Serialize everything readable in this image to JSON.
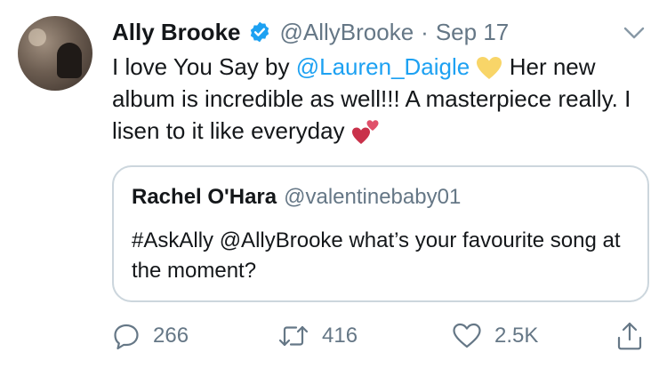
{
  "tweet": {
    "author_name": "Ally Brooke",
    "handle": "@AllyBrooke",
    "separator": "·",
    "date": "Sep 17",
    "text_part1": "I love You Say by ",
    "mention": "@Lauren_Daigle",
    "text_part2": " Her new album is incredible as well!!! A masterpiece really. I lisen to it like everyday "
  },
  "quote": {
    "author_name": "Rachel O'Hara",
    "handle": "@valentinebaby01",
    "text": "#AskAlly @AllyBrooke what’s your favourite song at the moment?"
  },
  "actions": {
    "replies": "266",
    "retweets": "416",
    "likes": "2.5K"
  },
  "icons": {
    "verified": "verified-badge-icon",
    "chevron": "chevron-down-icon",
    "reply": "reply-icon",
    "retweet": "retweet-icon",
    "like": "heart-icon",
    "share": "share-icon",
    "yellow_heart": "yellow-heart-emoji",
    "two_hearts": "two-hearts-emoji"
  },
  "colors": {
    "link": "#1da1f2",
    "secondary_text": "#657786",
    "border": "#ccd6dd"
  }
}
